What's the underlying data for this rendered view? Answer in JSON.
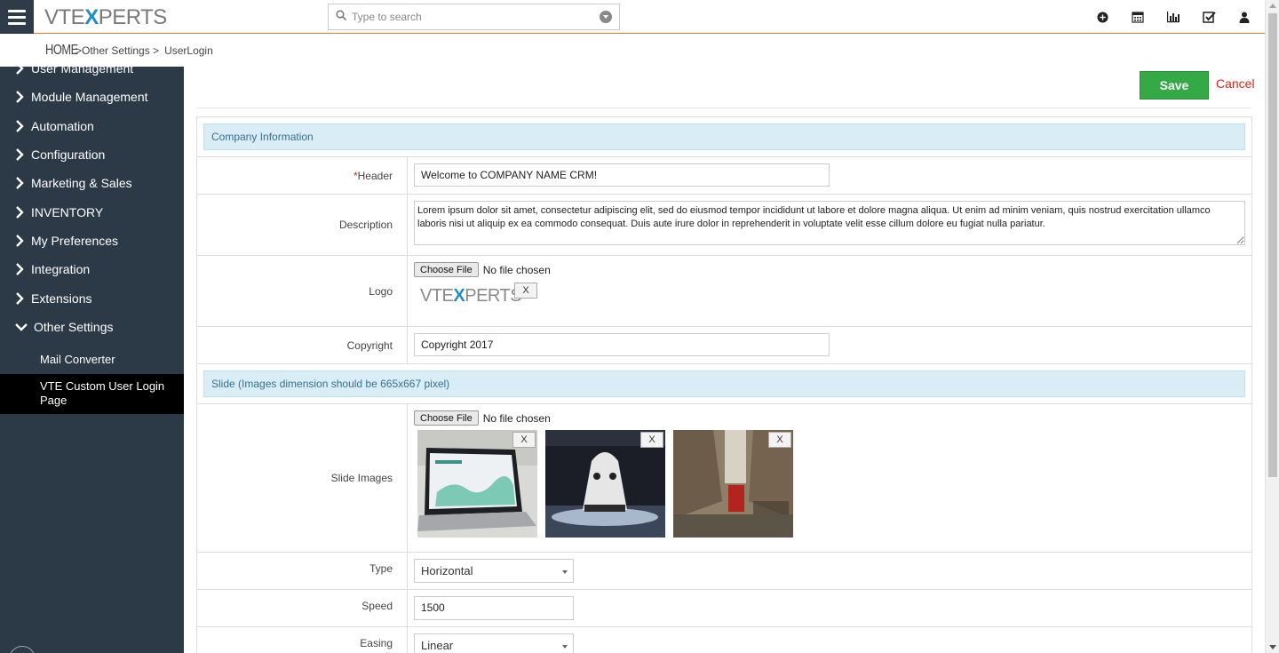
{
  "app": {
    "logo_prefix": "VTE",
    "logo_x": "X",
    "logo_suffix": "PERTS"
  },
  "search": {
    "placeholder": "Type to search"
  },
  "breadcrumb": {
    "home": "HOME",
    "items": [
      ">Other Settings >",
      "UserLogin"
    ]
  },
  "sidebar": {
    "items": [
      {
        "label": "User Management"
      },
      {
        "label": "Module Management"
      },
      {
        "label": "Automation"
      },
      {
        "label": "Configuration"
      },
      {
        "label": "Marketing & Sales"
      },
      {
        "label": "INVENTORY"
      },
      {
        "label": "My Preferences"
      },
      {
        "label": "Integration"
      },
      {
        "label": "Extensions"
      },
      {
        "label": "Other Settings"
      }
    ],
    "subitems": [
      {
        "label": "Mail Converter"
      },
      {
        "label": "VTE Custom User Login Page"
      }
    ]
  },
  "toolbar": {
    "save_label": "Save",
    "cancel_label": "Cancel"
  },
  "sections": {
    "company_info": "Company Information",
    "slide": "Slide (Images dimension should be 665x667 pixel)"
  },
  "fields": {
    "header": {
      "required_mark": "*",
      "label": "Header",
      "value": "Welcome to COMPANY NAME CRM!"
    },
    "description": {
      "label": "Description",
      "value": "Lorem ipsum dolor sit amet, consectetur adipiscing elit, sed do eiusmod tempor incididunt ut labore et dolore magna aliqua. Ut enim ad minim veniam, quis nostrud exercitation ullamco laboris nisi ut aliquip ex ea commodo consequat. Duis aute irure dolor in reprehenderit in voluptate velit esse cillum dolore eu fugiat nulla pariatur."
    },
    "logo": {
      "label": "Logo",
      "choose_label": "Choose File",
      "no_file": "No file chosen",
      "remove": "X",
      "logo_prefix": "VTE",
      "logo_x": "X",
      "logo_suffix": "PERTS"
    },
    "copyright": {
      "label": "Copyright",
      "value": "Copyright 2017"
    },
    "slide_images": {
      "label": "Slide Images",
      "choose_label": "Choose File",
      "no_file": "No file chosen",
      "remove": "X"
    },
    "type": {
      "label": "Type",
      "value": "Horizontal"
    },
    "speed": {
      "label": "Speed",
      "value": "1500"
    },
    "easing": {
      "label": "Easing",
      "value": "Linear"
    }
  },
  "colors": {
    "sidebar_bg": "#2c3a48",
    "save_green": "#35a945",
    "cancel_red": "#d9261c",
    "section_bg": "#d9edf7",
    "accent_orange": "#e07b39"
  }
}
